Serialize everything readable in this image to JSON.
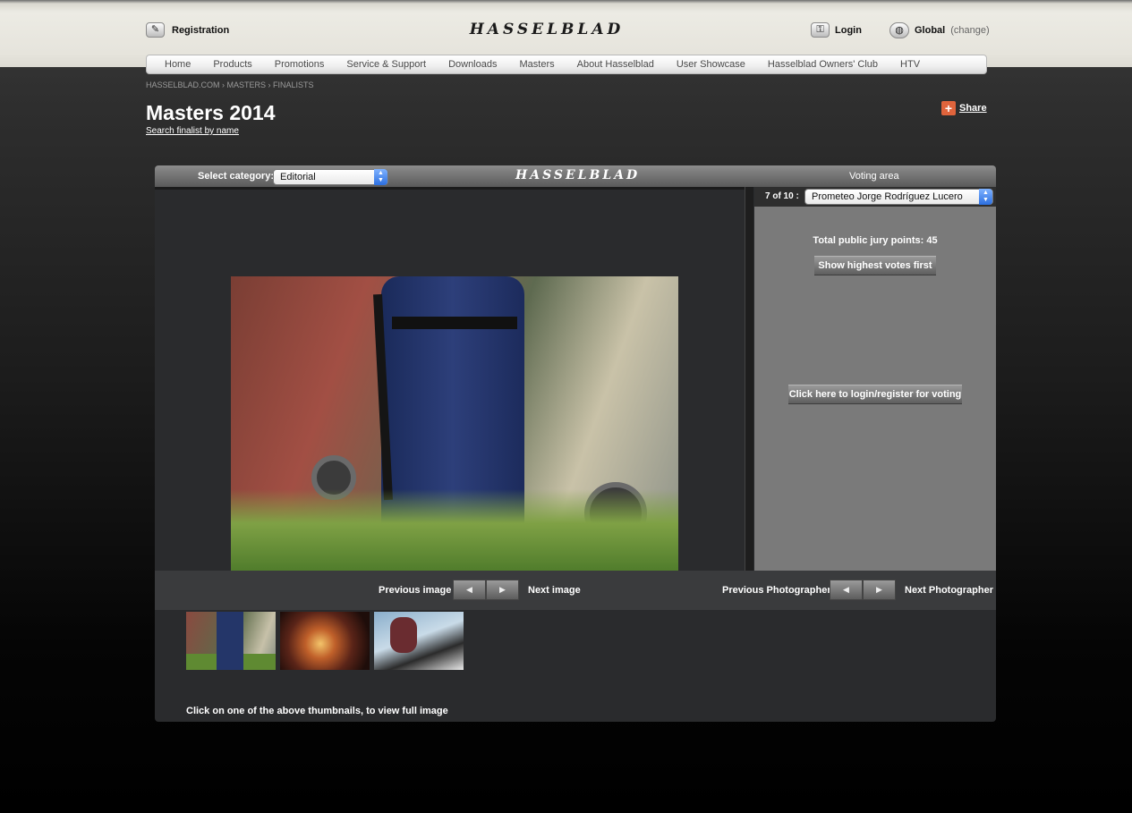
{
  "header": {
    "registration_label": "Registration",
    "brand": "HASSELBLAD",
    "login_label": "Login",
    "global_label": "Global",
    "change_label": "(change)"
  },
  "nav": {
    "items": [
      "Home",
      "Products",
      "Promotions",
      "Service & Support",
      "Downloads",
      "Masters",
      "About Hasselblad",
      "User Showcase",
      "Hasselblad Owners' Club",
      "HTV"
    ]
  },
  "breadcrumb": "HASSELBLAD.COM  › MASTERS  › FINALISTS",
  "page": {
    "title": "Masters 2014",
    "search_link": "Search finalist by name",
    "share_label": "Share"
  },
  "panel": {
    "category_label": "Select category:",
    "category_value": "Editorial",
    "brand": "HASSELBLAD",
    "voting_label": "Voting area",
    "count_label": "7 of 10 :",
    "photographer_value": "Prometeo Jorge Rodríguez Lucero",
    "jury_points": "Total public jury points: 45",
    "show_highest": "Show highest votes first",
    "login_vote": "Click here to login/register for voting",
    "prev_image": "Previous image",
    "next_image": "Next image",
    "prev_photographer": "Previous Photographer",
    "next_photographer": "Next Photographer",
    "thumb_hint": "Click on one of the above thumbnails, to view full image"
  },
  "icons": {
    "registration": "pen-icon",
    "login": "key-icon",
    "global": "globe-icon",
    "share": "plus-icon",
    "select_arrow": "updown-arrow-icon",
    "prev": "arrow-left-icon",
    "next": "arrow-right-icon"
  },
  "colors": {
    "accent_share": "#e0643c",
    "select_arrow": "#2c6fe0",
    "voting_bg": "#7a7a7a",
    "panel_bg": "#2a2b2d"
  }
}
